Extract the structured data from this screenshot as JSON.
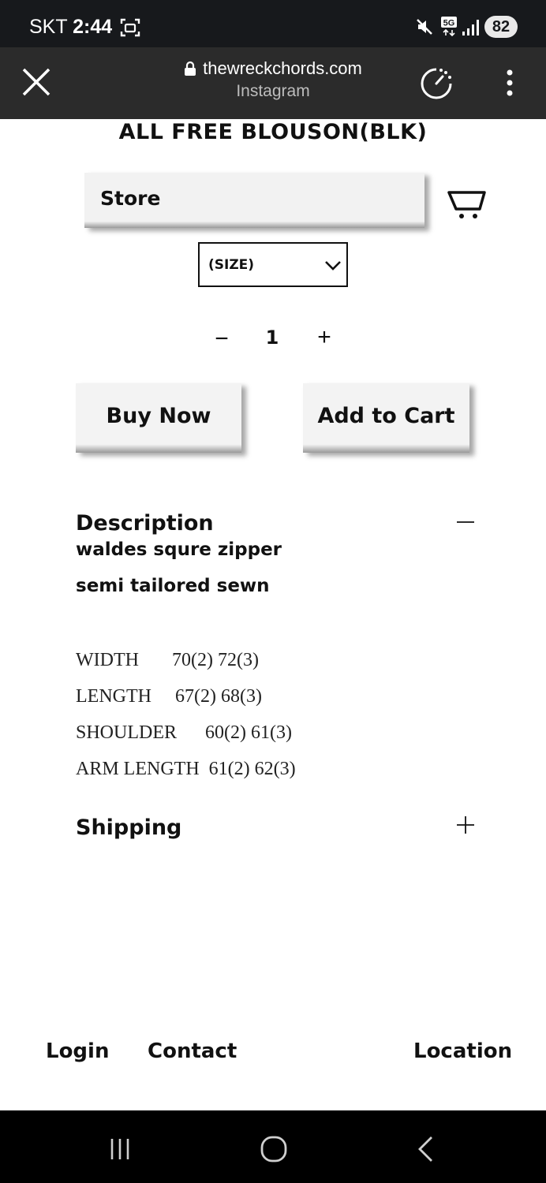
{
  "status_bar": {
    "carrier": "SKT",
    "time": "2:44",
    "network": "5G",
    "battery": "82",
    "icons": [
      "screenshot-icon",
      "mute-icon",
      "5g-icon",
      "signal-icon"
    ]
  },
  "browser": {
    "url": "thewreckchords.com",
    "source": "Instagram"
  },
  "product": {
    "title": "ALL FREE BLOUSON(BLK)"
  },
  "store_bar": {
    "label": "Store"
  },
  "size_select": {
    "selected": "(SIZE)"
  },
  "quantity": {
    "minus": "−",
    "value": "1",
    "plus": "+"
  },
  "actions": {
    "buy_now": "Buy Now",
    "add_to_cart": "Add to Cart"
  },
  "description": {
    "heading": "Description",
    "lines": [
      "waldes squre zipper",
      "semi tailored sewn"
    ],
    "specs": [
      "WIDTH       70(2) 72(3)",
      "LENGTH     67(2) 68(3)",
      "SHOULDER      60(2) 61(3)",
      "ARM LENGTH  61(2) 62(3)"
    ]
  },
  "shipping": {
    "heading": "Shipping"
  },
  "footer": {
    "login": "Login",
    "contact": "Contact",
    "location": "Location"
  },
  "colors": {
    "status_bar": "#17191c",
    "toolbar": "#2b2b2b",
    "button_bg": "#f3f3f3",
    "text": "#111111"
  }
}
